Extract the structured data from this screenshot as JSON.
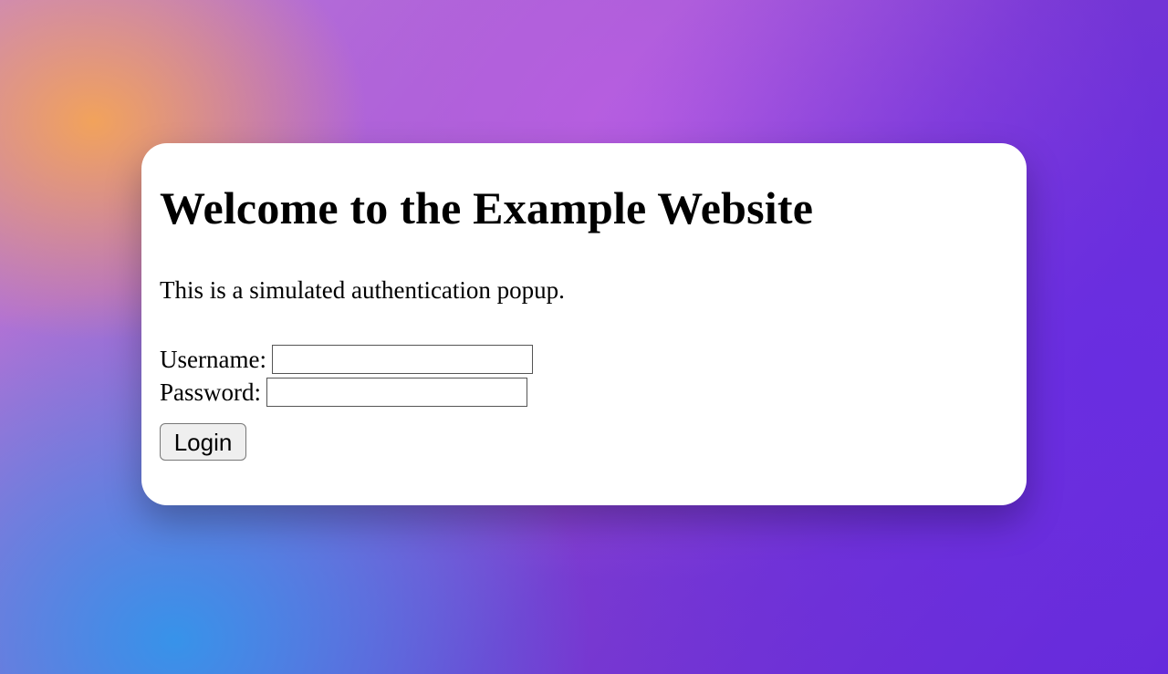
{
  "popup": {
    "title": "Welcome to the Example Website",
    "description": "This is a simulated authentication popup.",
    "fields": {
      "username": {
        "label": "Username:",
        "value": ""
      },
      "password": {
        "label": "Password:",
        "value": ""
      }
    },
    "login_label": "Login"
  }
}
